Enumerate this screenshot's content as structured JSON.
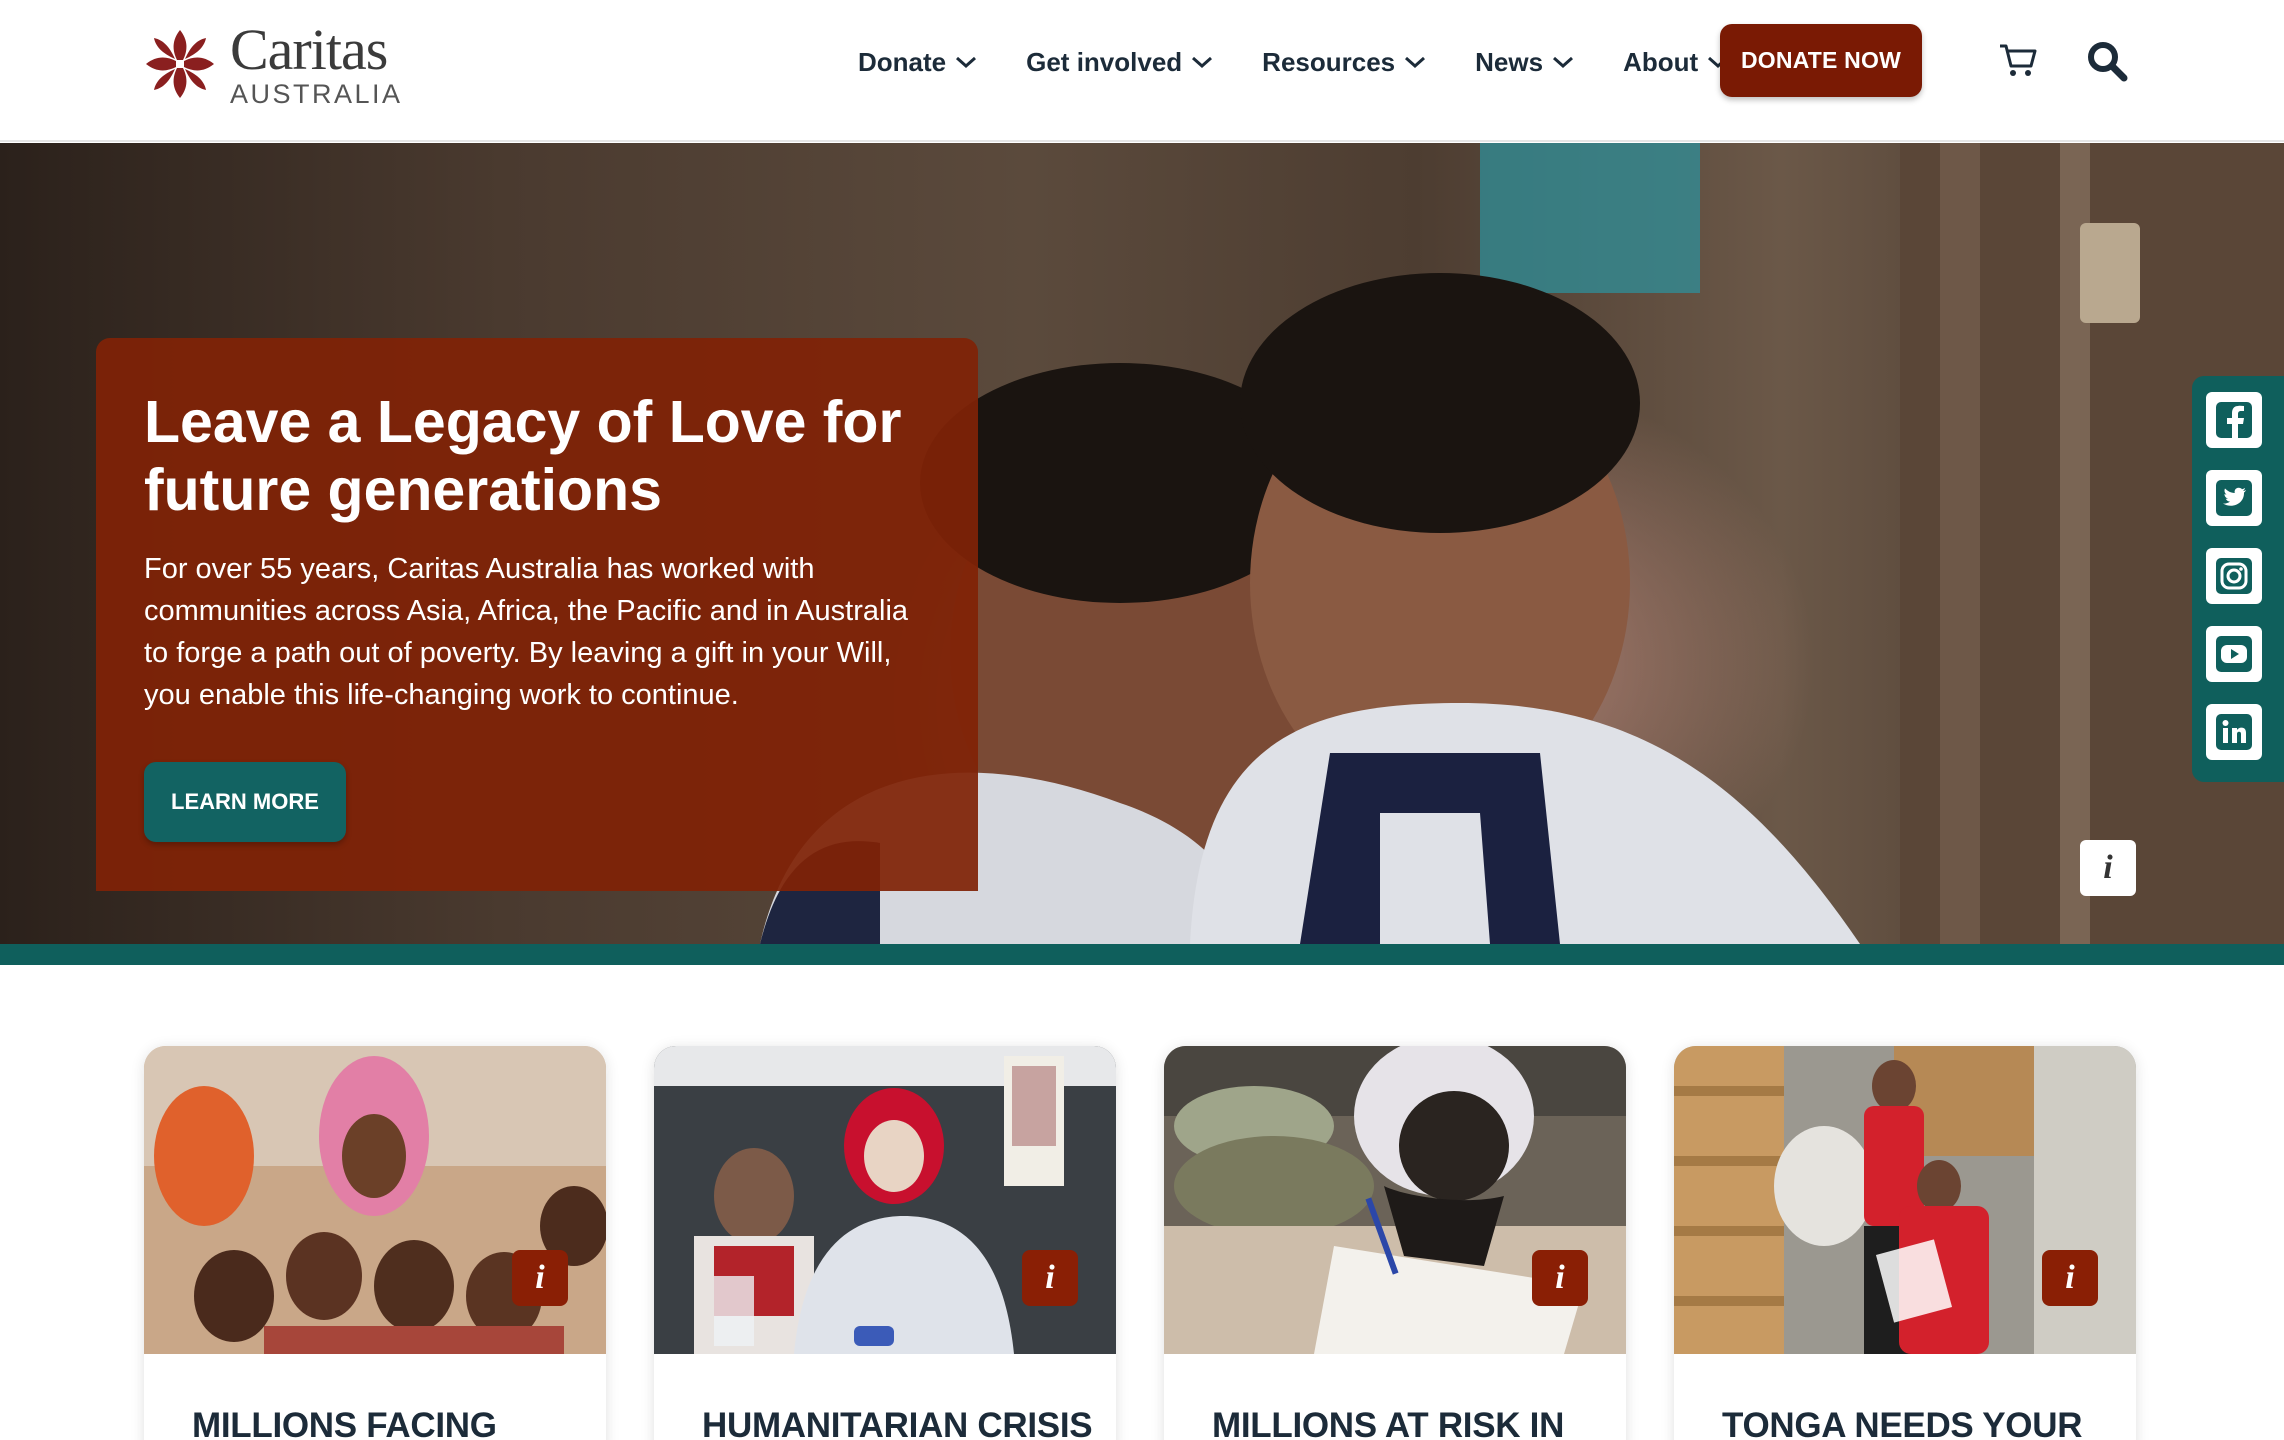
{
  "brand": {
    "name": "Caritas",
    "subtitle": "AUSTRALIA",
    "accent": "#7a1a04",
    "teal": "#0f5f5c"
  },
  "nav": {
    "items": [
      {
        "label": "Donate"
      },
      {
        "label": "Get involved"
      },
      {
        "label": "Resources"
      },
      {
        "label": "News"
      },
      {
        "label": "About"
      }
    ],
    "donate_now": "DONATE NOW",
    "cart_icon": "cart-icon",
    "search_icon": "search-icon"
  },
  "hero": {
    "title": "Leave a Legacy of Love for future generations",
    "text": "For over 55 years, Caritas Australia has worked with communities across Asia, Africa, the Pacific and in Australia to forge a path out of poverty. By leaving a gift in your Will, you enable this life-changing work to continue.",
    "cta": "LEARN MORE",
    "info": "i"
  },
  "social": {
    "items": [
      "facebook-icon",
      "twitter-icon",
      "instagram-icon",
      "youtube-icon",
      "linkedin-icon"
    ]
  },
  "cards": [
    {
      "title": "MILLIONS FACING",
      "info": "i"
    },
    {
      "title": "HUMANITARIAN CRISIS",
      "info": "i"
    },
    {
      "title": "MILLIONS AT RISK IN",
      "info": "i"
    },
    {
      "title": "TONGA NEEDS YOUR",
      "info": "i"
    }
  ]
}
